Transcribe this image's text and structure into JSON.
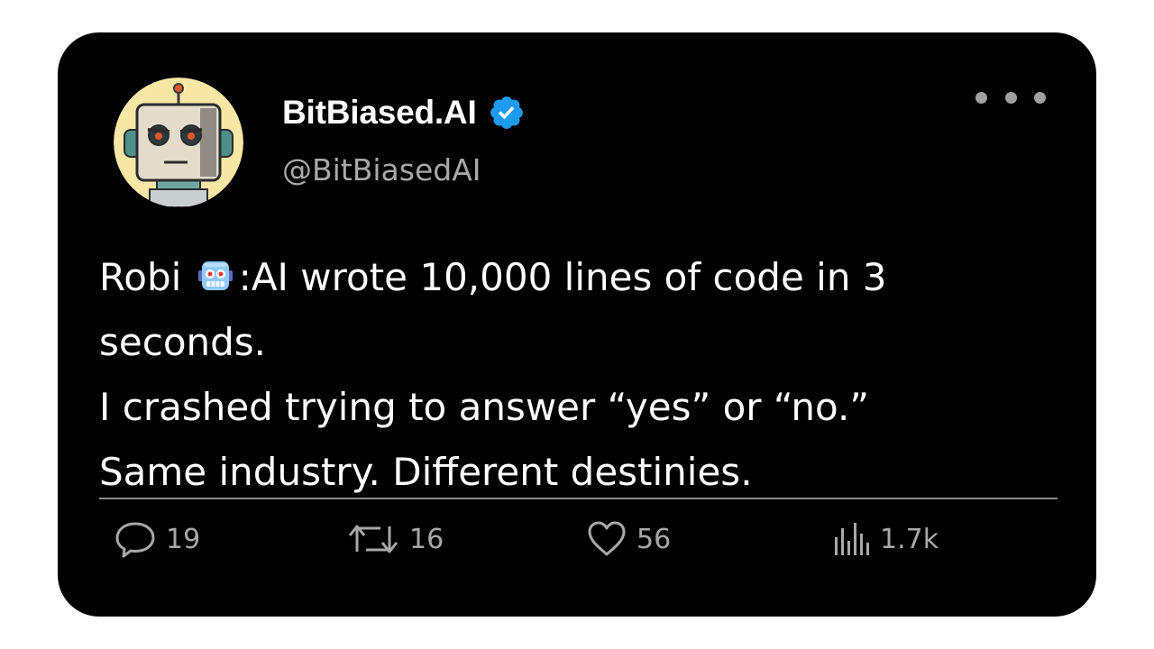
{
  "post": {
    "display_name": "BitBiased.AI",
    "handle": "@BitBiasedAI",
    "verified": true,
    "text": {
      "line1_before_emoji": "Robi ",
      "emoji": "robot-face",
      "line1_after_emoji": ":AI wrote 10,000 lines of code in 3",
      "line2": "seconds.",
      "line3": "I crashed trying to answer “yes” or “no.”",
      "line4": "Same industry. Different destinies."
    }
  },
  "actions": {
    "replies": "19",
    "retweets": "16",
    "likes": "56",
    "views": "1.7k"
  },
  "colors": {
    "card_background": "#000000",
    "page_background": "#ffffff",
    "verified_badge": "#1d9bf0",
    "secondary_text": "#a8a8a8",
    "avatar_background": "#f6e7a5"
  },
  "icons": {
    "more": "more-dots-icon",
    "reply": "reply-bubble-icon",
    "retweet": "retweet-icon",
    "like": "heart-icon",
    "views": "views-bar-chart-icon"
  }
}
